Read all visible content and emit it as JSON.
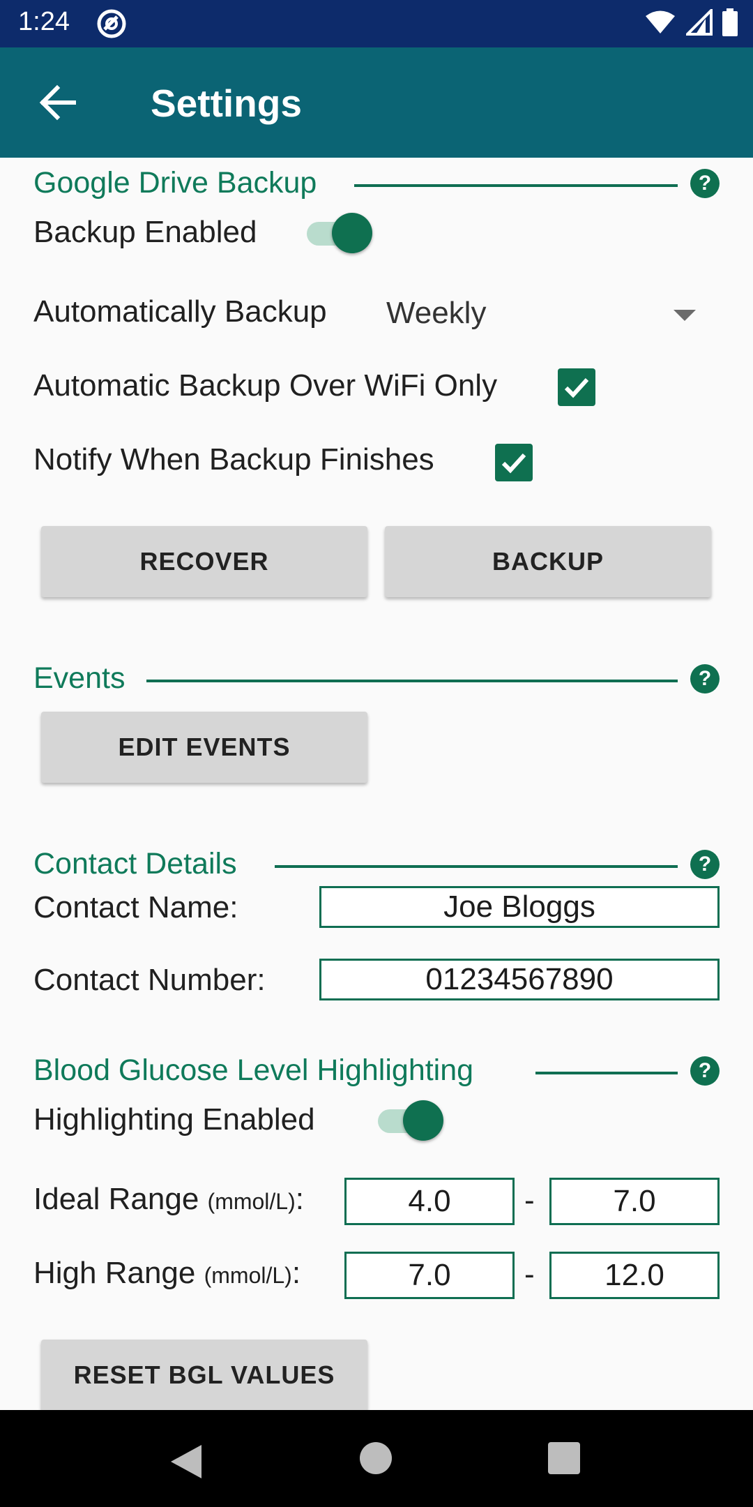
{
  "status_bar": {
    "time": "1:24"
  },
  "app_bar": {
    "title": "Settings"
  },
  "google_drive": {
    "section_title": "Google Drive Backup",
    "backup_enabled_label": "Backup Enabled",
    "backup_enabled": true,
    "auto_backup_label": "Automatically Backup",
    "auto_backup_value": "Weekly",
    "wifi_only_label": "Automatic Backup Over WiFi Only",
    "wifi_only": true,
    "notify_label": "Notify When Backup Finishes",
    "notify": true,
    "recover_button": "RECOVER",
    "backup_button": "BACKUP"
  },
  "events": {
    "section_title": "Events",
    "edit_button": "EDIT EVENTS"
  },
  "contact": {
    "section_title": "Contact Details",
    "name_label": "Contact Name:",
    "name_value": "Joe Bloggs",
    "number_label": "Contact Number:",
    "number_value": "01234567890"
  },
  "bgl": {
    "section_title": "Blood Glucose Level Highlighting",
    "highlight_label": "Highlighting Enabled",
    "highlight_enabled": true,
    "ideal_label": "Ideal Range",
    "ideal_unit": "(mmol/L)",
    "ideal_low": "4.0",
    "ideal_high": "7.0",
    "high_label": "High Range",
    "high_unit": "(mmol/L)",
    "high_low": "7.0",
    "high_high": "12.0",
    "range_separator": "-",
    "reset_button": "RESET BGL VALUES"
  },
  "colors": {
    "status_bar": "#0d2b6b",
    "app_bar": "#0b6474",
    "accent": "#0f7050",
    "section_title": "#0f7a5a"
  }
}
